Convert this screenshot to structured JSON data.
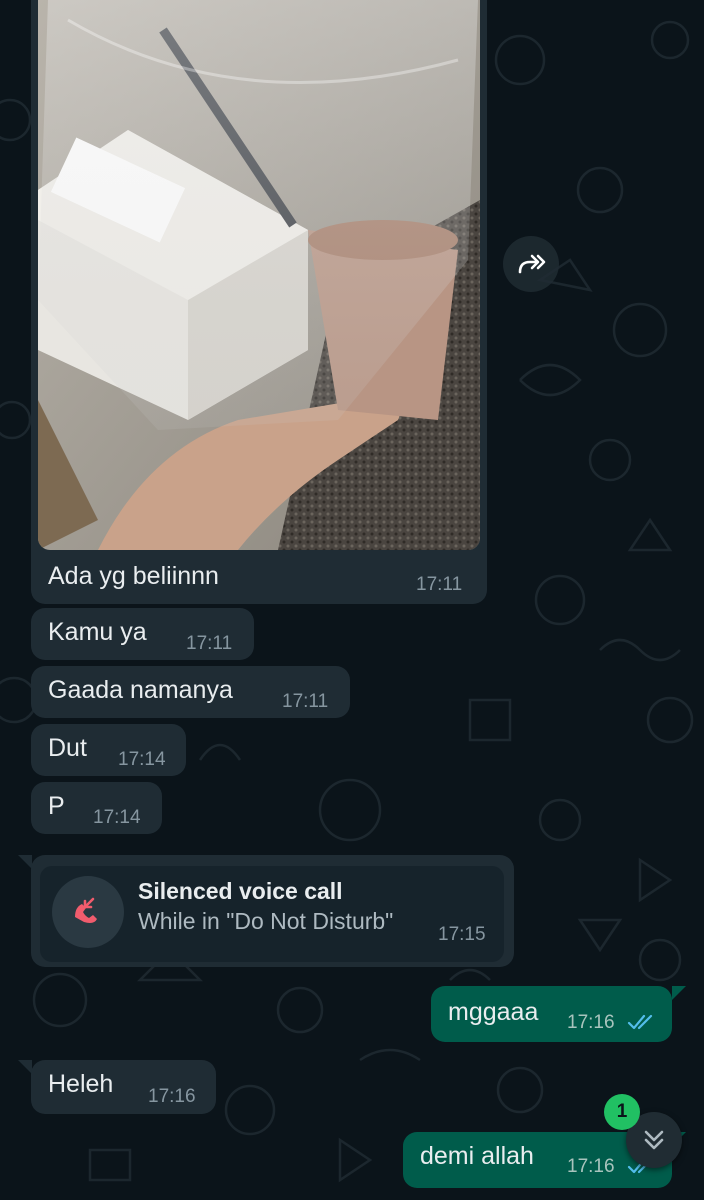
{
  "chat": {
    "image_message": {
      "caption": "Ada yg beliinnn",
      "time": "17:11"
    },
    "incoming": [
      {
        "text": "Kamu ya",
        "time": "17:11"
      },
      {
        "text": "Gaada namanya",
        "time": "17:11"
      },
      {
        "text": "Dut",
        "time": "17:14"
      },
      {
        "text": "P",
        "time": "17:14"
      }
    ],
    "call": {
      "title": "Silenced voice call",
      "subtitle": "While in \"Do Not Disturb\"",
      "time": "17:15"
    },
    "outgoing_1": {
      "text": "mggaaa",
      "time": "17:16",
      "status": "read"
    },
    "incoming_2": {
      "text": "Heleh",
      "time": "17:16"
    },
    "outgoing_2": {
      "text": "demi allah",
      "time": "17:16",
      "status": "read"
    },
    "unread_count": "1"
  },
  "icons": {
    "forward": "forward-icon",
    "missed_call": "missed-call-icon",
    "scroll_down": "double-chevron-down-icon",
    "read_ticks": "double-check-icon"
  },
  "colors": {
    "background": "#0b141a",
    "incoming_bubble": "#1f2c34",
    "outgoing_bubble": "#005c4b",
    "read_tick": "#53bdeb",
    "missed_call_red": "#f15c6d",
    "badge": "#21c063"
  }
}
